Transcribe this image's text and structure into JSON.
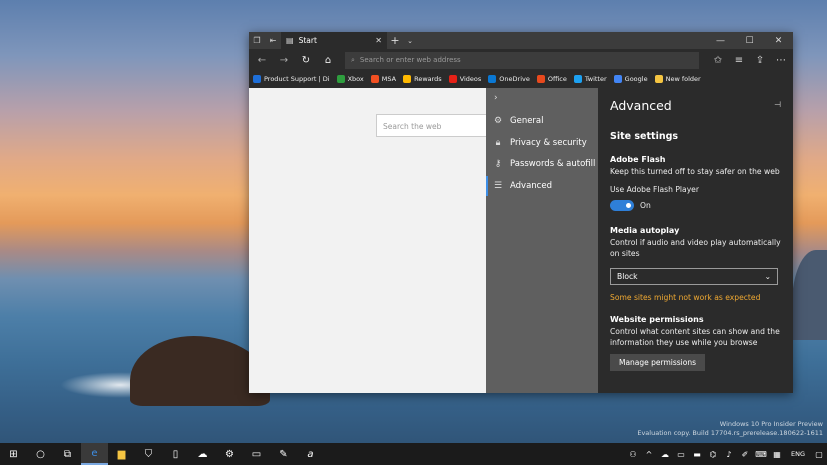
{
  "browser": {
    "tab_title": "Start",
    "address_placeholder": "Search or enter web address",
    "favorites": [
      {
        "label": "Product Support | Di",
        "color": "#1e6fd9"
      },
      {
        "label": "Xbox",
        "color": "#2e9e3e"
      },
      {
        "label": "MSA",
        "color": "#f25022"
      },
      {
        "label": "Rewards",
        "color": "#ffb900"
      },
      {
        "label": "Videos",
        "color": "#e62117"
      },
      {
        "label": "OneDrive",
        "color": "#0a78d4"
      },
      {
        "label": "Office",
        "color": "#e8491d"
      },
      {
        "label": "Twitter",
        "color": "#1da1f2"
      },
      {
        "label": "Google",
        "color": "#4285f4"
      },
      {
        "label": "New folder",
        "color": "#f5c542"
      }
    ],
    "page_search_placeholder": "Search the web"
  },
  "settings_menu": {
    "items": [
      {
        "label": "General",
        "icon": "gear-icon"
      },
      {
        "label": "Privacy & security",
        "icon": "lock-icon"
      },
      {
        "label": "Passwords & autofill",
        "icon": "key-icon"
      },
      {
        "label": "Advanced",
        "icon": "sliders-icon"
      }
    ],
    "active": "Advanced"
  },
  "advanced_panel": {
    "title": "Advanced",
    "site_settings": "Site settings",
    "flash_heading": "Adobe Flash",
    "flash_desc": "Keep this turned off to stay safer on the web",
    "flash_toggle_label": "Use Adobe Flash Player",
    "flash_toggle_state": "On",
    "autoplay_heading": "Media autoplay",
    "autoplay_desc": "Control if audio and video play automatically on sites",
    "autoplay_value": "Block",
    "autoplay_warning": "Some sites might not work as expected",
    "permissions_heading": "Website permissions",
    "permissions_desc": "Control what content sites can show and the information they use while you browse",
    "permissions_button": "Manage permissions"
  },
  "desktop": {
    "watermark_line1": "Windows 10 Pro Insider Preview",
    "watermark_line2": "Evaluation copy. Build 17704.rs_prerelease.180622-1611"
  },
  "taskbar": {
    "language": "ENG"
  },
  "colors": {
    "accent": "#2e7fd8",
    "warning": "#f0a932",
    "panel_bg": "#2b2b2b",
    "menu_bg": "#5f5f5f"
  }
}
